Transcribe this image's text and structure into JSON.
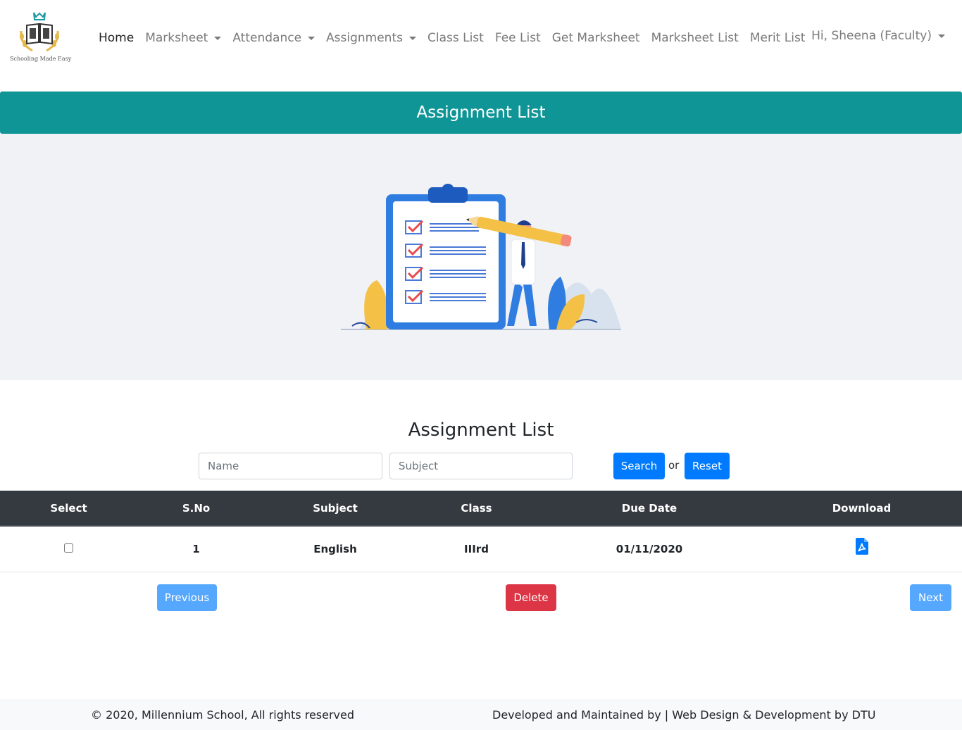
{
  "brand": {
    "tagline": "Schooling Made Easy"
  },
  "nav": {
    "items": [
      {
        "label": "Home",
        "active": true,
        "dropdown": false
      },
      {
        "label": "Marksheet",
        "active": false,
        "dropdown": true
      },
      {
        "label": "Attendance",
        "active": false,
        "dropdown": true
      },
      {
        "label": "Assignments",
        "active": false,
        "dropdown": true
      },
      {
        "label": "Class List",
        "active": false,
        "dropdown": false
      },
      {
        "label": "Fee List",
        "active": false,
        "dropdown": false
      },
      {
        "label": "Get Marksheet",
        "active": false,
        "dropdown": false
      },
      {
        "label": "Marksheet List",
        "active": false,
        "dropdown": false
      },
      {
        "label": "Merit List",
        "active": false,
        "dropdown": false
      }
    ],
    "user_label": "Hi, Sheena (Faculty)"
  },
  "banner": {
    "title": "Assignment List"
  },
  "content": {
    "title": "Assignment List",
    "search": {
      "name_placeholder": "Name",
      "subject_placeholder": "Subject",
      "search_label": "Search",
      "or_label": "or",
      "reset_label": "Reset"
    },
    "table": {
      "headers": [
        "Select",
        "S.No",
        "Subject",
        "Class",
        "Due Date",
        "Download"
      ],
      "rows": [
        {
          "sno": "1",
          "subject": "English",
          "class": "IIIrd",
          "due_date": "01/11/2020",
          "selected": false
        }
      ]
    },
    "pagination": {
      "previous_label": "Previous",
      "delete_label": "Delete",
      "next_label": "Next"
    }
  },
  "footer": {
    "copyright": "© 2020, Millennium School, All rights reserved",
    "credits": "Developed and Maintained by | Web Design & Development by DTU"
  },
  "colors": {
    "teal": "#109596",
    "primary": "#007bff",
    "danger": "#dc3545",
    "table_header": "#343a40"
  }
}
